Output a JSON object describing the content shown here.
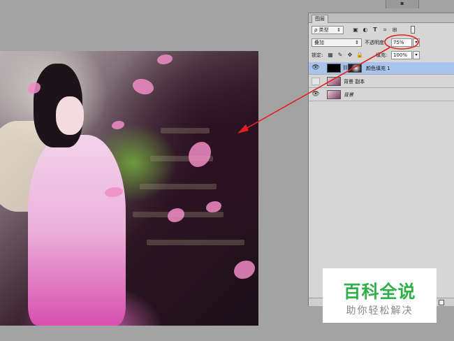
{
  "panel": {
    "tab_label": "图层",
    "filter_label": "ρ 类型",
    "filter_tools": [
      "image-filter-icon",
      "adjustment-filter-icon",
      "type-filter-icon",
      "shape-filter-icon",
      "smart-filter-icon"
    ],
    "blend_mode": "叠加",
    "opacity_label": "不透明度:",
    "opacity_value": "75%",
    "lock_label": "锁定:",
    "fill_label": "填充:",
    "fill_value": "100%",
    "layers": [
      {
        "name": "颜色填充 1",
        "visible": true,
        "selected": true
      },
      {
        "name": "背景 副本",
        "visible": false,
        "selected": false
      },
      {
        "name": "背景",
        "visible": true,
        "selected": false
      }
    ]
  },
  "annotation": {
    "color": "#e02020"
  },
  "watermark": {
    "title": "百科全说",
    "subtitle": "助你轻松解决"
  }
}
